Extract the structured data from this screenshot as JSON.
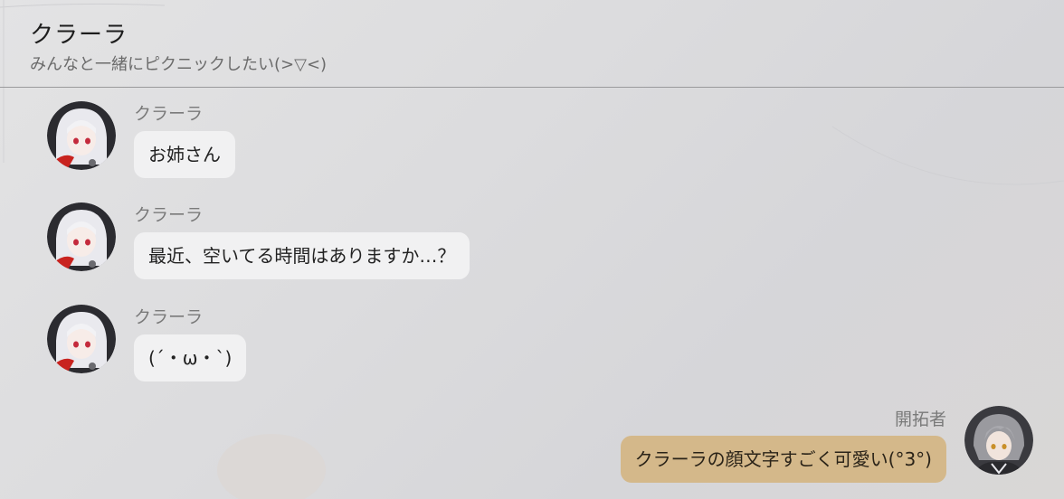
{
  "header": {
    "title": "クラーラ",
    "subtitle": "みんなと一緒にピクニックしたい(>▽<)"
  },
  "messages": [
    {
      "sender": "クラーラ",
      "text": "お姉さん",
      "avatar": "clara-avatar"
    },
    {
      "sender": "クラーラ",
      "text": "最近、空いてる時間はありますか…？",
      "avatar": "clara-avatar"
    },
    {
      "sender": "クラーラ",
      "text": "(´・ω・`)",
      "avatar": "clara-avatar"
    },
    {
      "sender": "開拓者",
      "text": "クラーラの顔文字すごく可愛い(°3°)",
      "avatar": "trailblazer-avatar"
    }
  ],
  "colors": {
    "incoming_bubble": "#f1f1f2",
    "outgoing_bubble": "#d4b88a"
  }
}
